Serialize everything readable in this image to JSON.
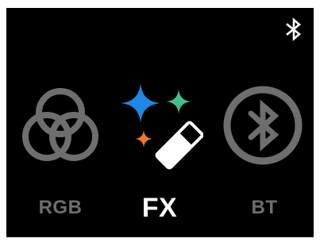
{
  "status_bar": {
    "bluetooth_icon": "bluetooth-icon"
  },
  "menu": {
    "items": [
      {
        "key": "rgb",
        "label": "RGB",
        "icon": "rgb-circles-icon",
        "selected": false
      },
      {
        "key": "fx",
        "label": "FX",
        "icon": "magic-wand-sparkles-icon",
        "selected": true
      },
      {
        "key": "bt",
        "label": "BT",
        "icon": "bluetooth-circle-icon",
        "selected": false
      }
    ]
  },
  "colors": {
    "background": "#000000",
    "inactive": "#6e6e6e",
    "active": "#ffffff",
    "sparkle_blue": "#1e88e5",
    "sparkle_green": "#43c08a",
    "sparkle_orange": "#f07a2a"
  }
}
